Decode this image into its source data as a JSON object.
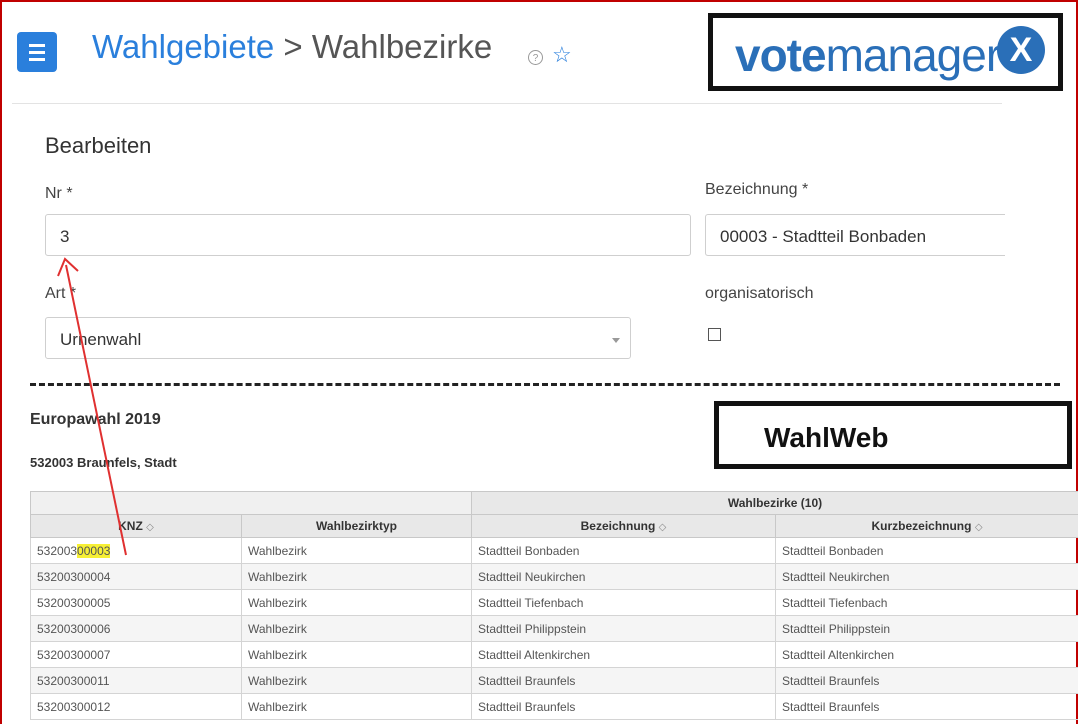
{
  "header": {
    "breadcrumb_parent": "Wahlgebiete",
    "breadcrumb_sep": ">",
    "breadcrumb_current": "Wahlbezirke",
    "help_glyph": "?",
    "menu_icon": "hamburger-icon",
    "favorite_icon": "star-icon"
  },
  "logo": {
    "text_bold": "vote",
    "text_thin": "manager",
    "badge": "X"
  },
  "form": {
    "section_title": "Bearbeiten",
    "nr_label": "Nr *",
    "nr_value": "3",
    "bezeichnung_label": "Bezeichnung *",
    "bezeichnung_value": "00003 - Stadtteil Bonbaden",
    "art_label": "Art *",
    "art_value": "Urnenwahl",
    "organisatorisch_label": "organisatorisch",
    "organisatorisch_checked": false
  },
  "wahlweb": {
    "label": "WahlWeb",
    "election_title": "Europawahl 2019",
    "municipality": "532003 Braunfels, Stadt",
    "group_header": "Wahlbezirke (10)",
    "columns": [
      "KNZ",
      "Wahlbezirktyp",
      "Bezeichnung",
      "Kurzbezeichnung"
    ],
    "sort_glyph": "◇",
    "rows": [
      {
        "knz_prefix": "532003",
        "knz_suffix": "00003",
        "typ": "Wahlbezirk",
        "bez": "Stadtteil Bonbaden",
        "kurz": "Stadtteil Bonbaden"
      },
      {
        "knz_prefix": "53200300004",
        "knz_suffix": "",
        "typ": "Wahlbezirk",
        "bez": "Stadtteil Neukirchen",
        "kurz": "Stadtteil Neukirchen"
      },
      {
        "knz_prefix": "53200300005",
        "knz_suffix": "",
        "typ": "Wahlbezirk",
        "bez": "Stadtteil Tiefenbach",
        "kurz": "Stadtteil Tiefenbach"
      },
      {
        "knz_prefix": "53200300006",
        "knz_suffix": "",
        "typ": "Wahlbezirk",
        "bez": "Stadtteil Philippstein",
        "kurz": "Stadtteil Philippstein"
      },
      {
        "knz_prefix": "53200300007",
        "knz_suffix": "",
        "typ": "Wahlbezirk",
        "bez": "Stadtteil Altenkirchen",
        "kurz": "Stadtteil Altenkirchen"
      },
      {
        "knz_prefix": "53200300011",
        "knz_suffix": "",
        "typ": "Wahlbezirk",
        "bez": "Stadtteil Braunfels",
        "kurz": "Stadtteil Braunfels"
      },
      {
        "knz_prefix": "53200300012",
        "knz_suffix": "",
        "typ": "Wahlbezirk",
        "bez": "Stadtteil Braunfels",
        "kurz": "Stadtteil Braunfels"
      }
    ]
  },
  "colors": {
    "accent": "#2a7fdc",
    "frame": "#c00000",
    "highlight": "#f7f035",
    "annotation_arrow": "#e03030"
  }
}
